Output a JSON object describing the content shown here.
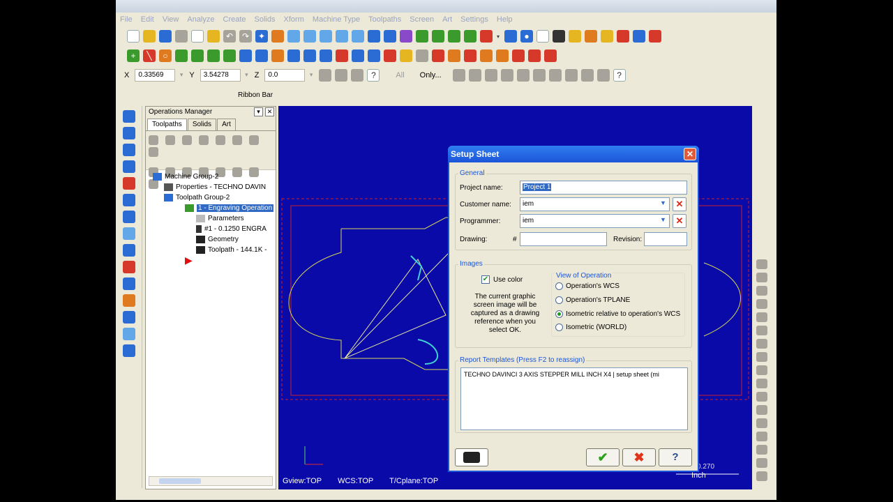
{
  "menu": [
    "File",
    "Edit",
    "View",
    "Analyze",
    "Create",
    "Solids",
    "Xform",
    "Machine Type",
    "Toolpaths",
    "Screen",
    "Art",
    "Settings",
    "Help"
  ],
  "coords": {
    "x_label": "X",
    "x_value": "0.33569",
    "y_label": "Y",
    "y_value": "3.54278",
    "z_label": "Z",
    "z_value": "0.0",
    "all_label": "All",
    "only_label": "Only..."
  },
  "ribbon_label": "Ribbon Bar",
  "ops": {
    "title": "Operations Manager",
    "tabs": [
      "Toolpaths",
      "Solids",
      "Art"
    ],
    "tree": {
      "machine_group": "Machine Group-2",
      "properties": "Properties - TECHNO DAVIN",
      "toolpath_group": "Toolpath Group-2",
      "operation": "1 - Engraving Operation",
      "parameters": "Parameters",
      "tool": "#1 - 0.1250 ENGRA",
      "geometry": "Geometry",
      "toolpath": "Toolpath - 144.1K -"
    }
  },
  "viewport": {
    "gview": "Gview:TOP",
    "wcs": "WCS:TOP",
    "tcplane": "T/Cplane:TOP",
    "scale_value": "0.270",
    "unit": "Inch"
  },
  "dialog": {
    "title": "Setup Sheet",
    "general_label": "General",
    "project_label": "Project name:",
    "project_value": "Project 1",
    "customer_label": "Customer name:",
    "customer_value": "iem",
    "programmer_label": "Programmer:",
    "programmer_value": "iem",
    "drawing_label": "Drawing:",
    "drawing_hash": "#",
    "drawing_value": "",
    "revision_label": "Revision:",
    "revision_value": "",
    "images_label": "Images",
    "use_color_label": "Use color",
    "images_desc": "The current graphic screen image will be captured as a drawing reference when you select OK.",
    "view_label": "View of Operation",
    "view_options": [
      "Operation's WCS",
      "Operation's TPLANE",
      "Isometric relative to operation's WCS",
      "Isometric (WORLD)"
    ],
    "view_selected": 2,
    "report_label": "Report Templates (Press F2 to reassign)",
    "report_value": "TECHNO DAVINCI 3 AXIS STEPPER MILL INCH X4   |   setup sheet (mi"
  },
  "colors": {
    "viewport_bg": "#0a0aa8",
    "title_blue": "#1c55d8",
    "selection": "#316ac5"
  }
}
